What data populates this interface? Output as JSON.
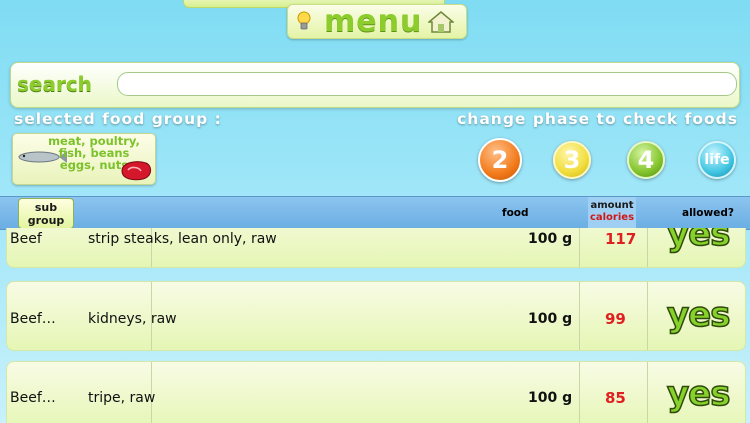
{
  "header": {
    "menu_label": "menu"
  },
  "search": {
    "label": "search",
    "value": "",
    "placeholder": ""
  },
  "food_group": {
    "selected_label": "selected food group :",
    "card_text": "meat, poultry,\nfish, beans\neggs, nuts"
  },
  "phases": {
    "label": "change phase to check foods",
    "buttons": [
      "2",
      "3",
      "4",
      "life"
    ],
    "active": "2"
  },
  "table": {
    "headers": {
      "sub_group": "sub\ngroup",
      "food": "food",
      "amount": "amount",
      "calories": "calories",
      "allowed": "allowed?"
    },
    "rows": [
      {
        "sub_group": "Beef",
        "description": "strip steaks, lean only, raw",
        "amount": "100 g",
        "calories": "117",
        "allowed": "yes"
      },
      {
        "sub_group": "Beef…",
        "description": "kidneys, raw",
        "amount": "100 g",
        "calories": "99",
        "allowed": "yes"
      },
      {
        "sub_group": "Beef…",
        "description": "tripe, raw",
        "amount": "100 g",
        "calories": "85",
        "allowed": "yes"
      }
    ]
  },
  "colors": {
    "accent_green": "#8ccc2c",
    "phase2_orange": "#f27b1b",
    "phase3_yellow": "#f1de3d",
    "phase4_green": "#84c42d",
    "life_blue": "#42c6e3",
    "calorie_red": "#e02020"
  },
  "icons": {
    "menu_left": "lightbulb-icon",
    "menu_right": "home-icon"
  }
}
